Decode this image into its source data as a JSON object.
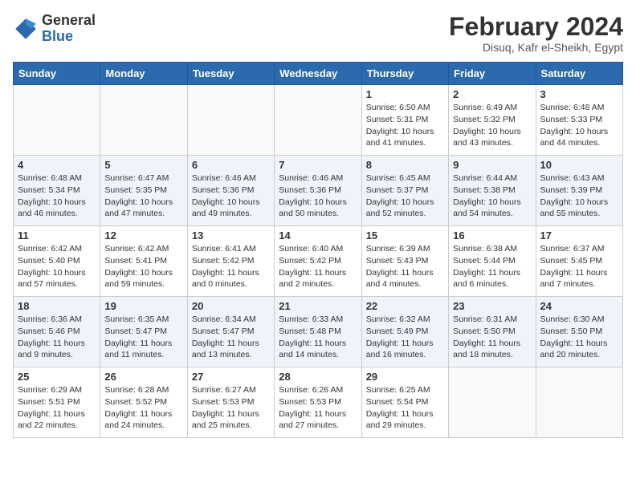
{
  "logo": {
    "general": "General",
    "blue": "Blue"
  },
  "title": "February 2024",
  "location": "Disuq, Kafr el-Sheikh, Egypt",
  "days_of_week": [
    "Sunday",
    "Monday",
    "Tuesday",
    "Wednesday",
    "Thursday",
    "Friday",
    "Saturday"
  ],
  "weeks": [
    [
      {
        "day": "",
        "info": ""
      },
      {
        "day": "",
        "info": ""
      },
      {
        "day": "",
        "info": ""
      },
      {
        "day": "",
        "info": ""
      },
      {
        "day": "1",
        "info": "Sunrise: 6:50 AM\nSunset: 5:31 PM\nDaylight: 10 hours and 41 minutes."
      },
      {
        "day": "2",
        "info": "Sunrise: 6:49 AM\nSunset: 5:32 PM\nDaylight: 10 hours and 43 minutes."
      },
      {
        "day": "3",
        "info": "Sunrise: 6:48 AM\nSunset: 5:33 PM\nDaylight: 10 hours and 44 minutes."
      }
    ],
    [
      {
        "day": "4",
        "info": "Sunrise: 6:48 AM\nSunset: 5:34 PM\nDaylight: 10 hours and 46 minutes."
      },
      {
        "day": "5",
        "info": "Sunrise: 6:47 AM\nSunset: 5:35 PM\nDaylight: 10 hours and 47 minutes."
      },
      {
        "day": "6",
        "info": "Sunrise: 6:46 AM\nSunset: 5:36 PM\nDaylight: 10 hours and 49 minutes."
      },
      {
        "day": "7",
        "info": "Sunrise: 6:46 AM\nSunset: 5:36 PM\nDaylight: 10 hours and 50 minutes."
      },
      {
        "day": "8",
        "info": "Sunrise: 6:45 AM\nSunset: 5:37 PM\nDaylight: 10 hours and 52 minutes."
      },
      {
        "day": "9",
        "info": "Sunrise: 6:44 AM\nSunset: 5:38 PM\nDaylight: 10 hours and 54 minutes."
      },
      {
        "day": "10",
        "info": "Sunrise: 6:43 AM\nSunset: 5:39 PM\nDaylight: 10 hours and 55 minutes."
      }
    ],
    [
      {
        "day": "11",
        "info": "Sunrise: 6:42 AM\nSunset: 5:40 PM\nDaylight: 10 hours and 57 minutes."
      },
      {
        "day": "12",
        "info": "Sunrise: 6:42 AM\nSunset: 5:41 PM\nDaylight: 10 hours and 59 minutes."
      },
      {
        "day": "13",
        "info": "Sunrise: 6:41 AM\nSunset: 5:42 PM\nDaylight: 11 hours and 0 minutes."
      },
      {
        "day": "14",
        "info": "Sunrise: 6:40 AM\nSunset: 5:42 PM\nDaylight: 11 hours and 2 minutes."
      },
      {
        "day": "15",
        "info": "Sunrise: 6:39 AM\nSunset: 5:43 PM\nDaylight: 11 hours and 4 minutes."
      },
      {
        "day": "16",
        "info": "Sunrise: 6:38 AM\nSunset: 5:44 PM\nDaylight: 11 hours and 6 minutes."
      },
      {
        "day": "17",
        "info": "Sunrise: 6:37 AM\nSunset: 5:45 PM\nDaylight: 11 hours and 7 minutes."
      }
    ],
    [
      {
        "day": "18",
        "info": "Sunrise: 6:36 AM\nSunset: 5:46 PM\nDaylight: 11 hours and 9 minutes."
      },
      {
        "day": "19",
        "info": "Sunrise: 6:35 AM\nSunset: 5:47 PM\nDaylight: 11 hours and 11 minutes."
      },
      {
        "day": "20",
        "info": "Sunrise: 6:34 AM\nSunset: 5:47 PM\nDaylight: 11 hours and 13 minutes."
      },
      {
        "day": "21",
        "info": "Sunrise: 6:33 AM\nSunset: 5:48 PM\nDaylight: 11 hours and 14 minutes."
      },
      {
        "day": "22",
        "info": "Sunrise: 6:32 AM\nSunset: 5:49 PM\nDaylight: 11 hours and 16 minutes."
      },
      {
        "day": "23",
        "info": "Sunrise: 6:31 AM\nSunset: 5:50 PM\nDaylight: 11 hours and 18 minutes."
      },
      {
        "day": "24",
        "info": "Sunrise: 6:30 AM\nSunset: 5:50 PM\nDaylight: 11 hours and 20 minutes."
      }
    ],
    [
      {
        "day": "25",
        "info": "Sunrise: 6:29 AM\nSunset: 5:51 PM\nDaylight: 11 hours and 22 minutes."
      },
      {
        "day": "26",
        "info": "Sunrise: 6:28 AM\nSunset: 5:52 PM\nDaylight: 11 hours and 24 minutes."
      },
      {
        "day": "27",
        "info": "Sunrise: 6:27 AM\nSunset: 5:53 PM\nDaylight: 11 hours and 25 minutes."
      },
      {
        "day": "28",
        "info": "Sunrise: 6:26 AM\nSunset: 5:53 PM\nDaylight: 11 hours and 27 minutes."
      },
      {
        "day": "29",
        "info": "Sunrise: 6:25 AM\nSunset: 5:54 PM\nDaylight: 11 hours and 29 minutes."
      },
      {
        "day": "",
        "info": ""
      },
      {
        "day": "",
        "info": ""
      }
    ]
  ]
}
